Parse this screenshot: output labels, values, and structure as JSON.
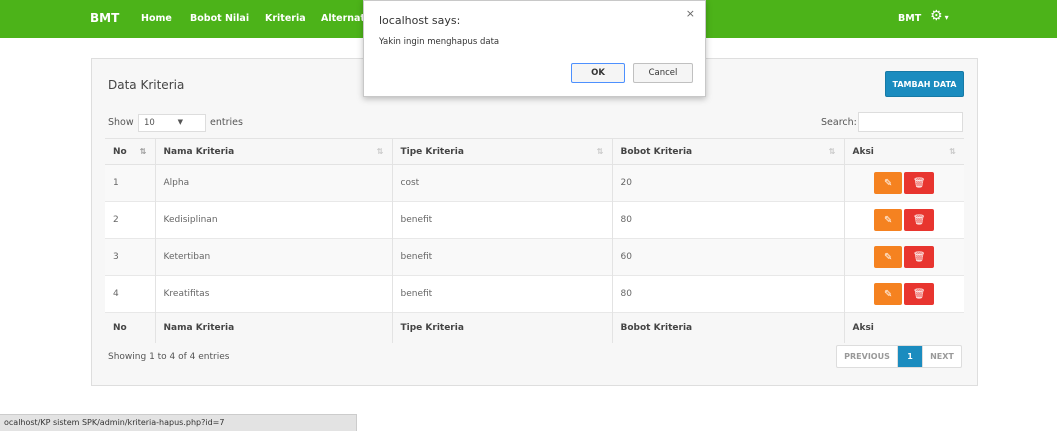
{
  "navbar": {
    "brand": "BMT",
    "items": [
      "Home",
      "Bobot Nilai",
      "Kriteria",
      "Alternati"
    ],
    "user": "BMT",
    "bg_color": "#4cb319"
  },
  "panel": {
    "title": "Data Kriteria",
    "add_button": "TAMBAH DATA",
    "show_label": "Show",
    "show_value": "10",
    "entries_label": "entries",
    "search_label": "Search:",
    "search_value": ""
  },
  "table": {
    "columns": [
      "No",
      "Nama Kriteria",
      "Tipe Kriteria",
      "Bobot Kriteria",
      "Aksi"
    ],
    "rows": [
      {
        "no": "1",
        "nama": "Alpha",
        "tipe": "cost",
        "bobot": "20"
      },
      {
        "no": "2",
        "nama": "Kedisiplinan",
        "tipe": "benefit",
        "bobot": "80"
      },
      {
        "no": "3",
        "nama": "Ketertiban",
        "tipe": "benefit",
        "bobot": "60"
      },
      {
        "no": "4",
        "nama": "Kreatifitas",
        "tipe": "benefit",
        "bobot": "80"
      }
    ],
    "footer": [
      "No",
      "Nama Kriteria",
      "Tipe Kriteria",
      "Bobot Kriteria",
      "Aksi"
    ]
  },
  "info": {
    "showing": "Showing 1 to 4 of 4 entries"
  },
  "pagination": {
    "previous": "PREVIOUS",
    "current": "1",
    "next": "NEXT"
  },
  "dialog": {
    "title": "localhost says:",
    "close": "×",
    "message": "Yakin ingin menghapus data",
    "ok": "OK",
    "cancel": "Cancel"
  },
  "statusbar": {
    "url": "ocalhost/KP sistem SPK/admin/kriteria-hapus.php?id=7"
  },
  "icons": {
    "settings": "gear-icon",
    "edit": "pencil-icon",
    "delete": "trash-icon"
  },
  "colors": {
    "primary": "#1b8cbf",
    "edit": "#f58220",
    "delete": "#e8352f"
  }
}
